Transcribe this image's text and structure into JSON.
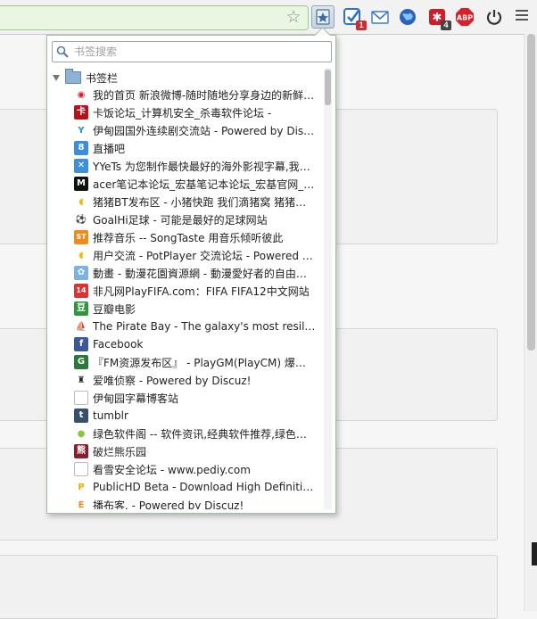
{
  "toolbar": {
    "extensions": [
      {
        "name": "bookmarks-extension-button",
        "icon": "bookmark-star-icon",
        "color": "#3a6ea8",
        "active": true,
        "badge": null
      },
      {
        "name": "checker-extension-button",
        "icon": "check-icon",
        "color": "#2f6fd1",
        "active": false,
        "badge": "1",
        "badge_color": "#d22b2b"
      },
      {
        "name": "mail-extension-button",
        "icon": "mail-icon",
        "color": "#3c78c7",
        "active": false,
        "badge": null
      },
      {
        "name": "globe-extension-button",
        "icon": "globe-icon",
        "color": "#2a63b8",
        "active": false,
        "badge": null
      },
      {
        "name": "puzzle-extension-button",
        "icon": "puzzle-icon",
        "color": "#cc1f2a",
        "active": false,
        "badge": "4",
        "badge_color": "#444444"
      },
      {
        "name": "adblock-button",
        "icon": "abp-icon",
        "label": "ABP",
        "color": "#d8202a",
        "active": false,
        "badge": null
      },
      {
        "name": "power-extension-button",
        "icon": "power-icon",
        "color": "#333333",
        "active": false,
        "badge": null
      }
    ]
  },
  "popup": {
    "search": {
      "placeholder": "书签搜索",
      "value": ""
    },
    "folder": {
      "label": "书签栏",
      "expanded": true
    },
    "bookmarks": [
      {
        "title": "我的首页 新浪微博-随时随地分享身边的新鲜事儿",
        "icon": "weibo-icon",
        "color": "#e6162d",
        "glyph": "◉",
        "fg": "#e6162d",
        "bg": "#ffffff"
      },
      {
        "title": "卡饭论坛_计算机安全_杀毒软件论坛 - ",
        "icon": "kafan-icon",
        "color": "#b5121b",
        "glyph": "卡",
        "fg": "#ffffff",
        "bg": "#b5121b"
      },
      {
        "title": "伊甸园国外连续剧交流站 - Powered by Discuz!",
        "icon": "yidianyuan-icon",
        "color": "#2a8fd8",
        "glyph": "Y",
        "fg": "#2a8fd8",
        "bg": "#ffffff"
      },
      {
        "title": "直播吧",
        "icon": "zhibo8-icon",
        "color": "#2a7fd4",
        "glyph": "8",
        "fg": "#ffffff",
        "bg": "#3b8de0"
      },
      {
        "title": "YYeTs 为您制作最快最好的海外影视字幕,我们的宗旨",
        "icon": "yyets-icon",
        "color": "#3d8fdc",
        "glyph": "✕",
        "fg": "#ffffff",
        "bg": "#3d8fdc"
      },
      {
        "title": "acer笔记本论坛_宏基笔记本论坛_宏基官网_acer",
        "icon": "acer-icon",
        "color": "#111111",
        "glyph": "M",
        "fg": "#ffffff",
        "bg": "#111111"
      },
      {
        "title": "猪猪BT发布区 - 小猪快跑 我们滴猪窝 猪猪字幕组",
        "icon": "zhuzhu-icon",
        "color": "#f5b800",
        "glyph": "◖",
        "fg": "#f5b800",
        "bg": "#ffffff"
      },
      {
        "title": "GoalHi足球 - 可能是最好的足球网站",
        "icon": "goalhi-icon",
        "color": "#d33a1d",
        "glyph": "⚽",
        "fg": "#d33a1d",
        "bg": "#ffffff"
      },
      {
        "title": "推荐音乐 -- SongTaste 用音乐倾听彼此",
        "icon": "songtaste-icon",
        "color": "#f08a1c",
        "glyph": "ST",
        "fg": "#ffffff",
        "bg": "#f08a1c"
      },
      {
        "title": "用户交流 - PotPlayer 交流论坛 - Powered by Discuz!",
        "icon": "potplayer-icon",
        "color": "#f5b800",
        "glyph": "◖",
        "fg": "#f5b800",
        "bg": "#ffffff"
      },
      {
        "title": "動畫 - 動漫花園資源網 - 動漫愛好者的自由交流",
        "icon": "dmhy-icon",
        "color": "#7ab3e0",
        "glyph": "✿",
        "fg": "#ffffff",
        "bg": "#7ab3e0"
      },
      {
        "title": "非凡网PlayFIFA.com：FIFA FIFA12中文网站",
        "icon": "playfifa-icon",
        "color": "#e03030",
        "glyph": "14",
        "fg": "#ffffff",
        "bg": "#e03030"
      },
      {
        "title": "豆瓣电影",
        "icon": "douban-icon",
        "color": "#2e963d",
        "glyph": "豆",
        "fg": "#ffffff",
        "bg": "#2e963d"
      },
      {
        "title": "The Pirate Bay - The galaxy's most resilient BitTorrent site",
        "icon": "piratebay-icon",
        "color": "#333333",
        "glyph": "⛵",
        "fg": "#333333",
        "bg": "#ffffff"
      },
      {
        "title": "Facebook",
        "icon": "facebook-icon",
        "color": "#3b5998",
        "glyph": "f",
        "fg": "#ffffff",
        "bg": "#3b5998"
      },
      {
        "title": "『FM资源发布区』 - PlayGM(PlayCM) 爆棚足球经理",
        "icon": "playgm-icon",
        "color": "#2b7a3b",
        "glyph": "G",
        "fg": "#ffffff",
        "bg": "#2b7a3b"
      },
      {
        "title": "爱唯侦察 - Powered by Discuz!",
        "icon": "aiwei-icon",
        "color": "#222222",
        "glyph": "♜",
        "fg": "#222222",
        "bg": "#ffffff"
      },
      {
        "title": "伊甸园字幕博客站",
        "icon": "blank-page-icon",
        "color": "#bbbbbb",
        "glyph": "",
        "fg": "#999999",
        "bg": "#ffffff"
      },
      {
        "title": "tumblr",
        "icon": "tumblr-icon",
        "color": "#34526f",
        "glyph": "t",
        "fg": "#ffffff",
        "bg": "#34526f"
      },
      {
        "title": "绿色软件阁 -- 软件资讯,经典软件推荐,绿色软件下载",
        "icon": "lvse-icon",
        "color": "#8cc63f",
        "glyph": "●",
        "fg": "#8cc63f",
        "bg": "#ffffff"
      },
      {
        "title": "破烂熊乐园",
        "icon": "polanxiong-icon",
        "color": "#8a1e2a",
        "glyph": "熊",
        "fg": "#ffffff",
        "bg": "#8a1e2a"
      },
      {
        "title": "看雪安全论坛 - www.pediy.com",
        "icon": "blank-page-icon",
        "color": "#bbbbbb",
        "glyph": "",
        "fg": "#999999",
        "bg": "#ffffff"
      },
      {
        "title": "PublicHD Beta - Download High Definition Movies",
        "icon": "publichd-icon",
        "color": "#f2a900",
        "glyph": "P",
        "fg": "#f2a900",
        "bg": "#ffffff"
      },
      {
        "title": "播布客. - Powered by Discuz!",
        "icon": "boobooke-icon",
        "color": "#e8891a",
        "glyph": "E",
        "fg": "#e8891a",
        "bg": "#ffffff"
      }
    ]
  }
}
